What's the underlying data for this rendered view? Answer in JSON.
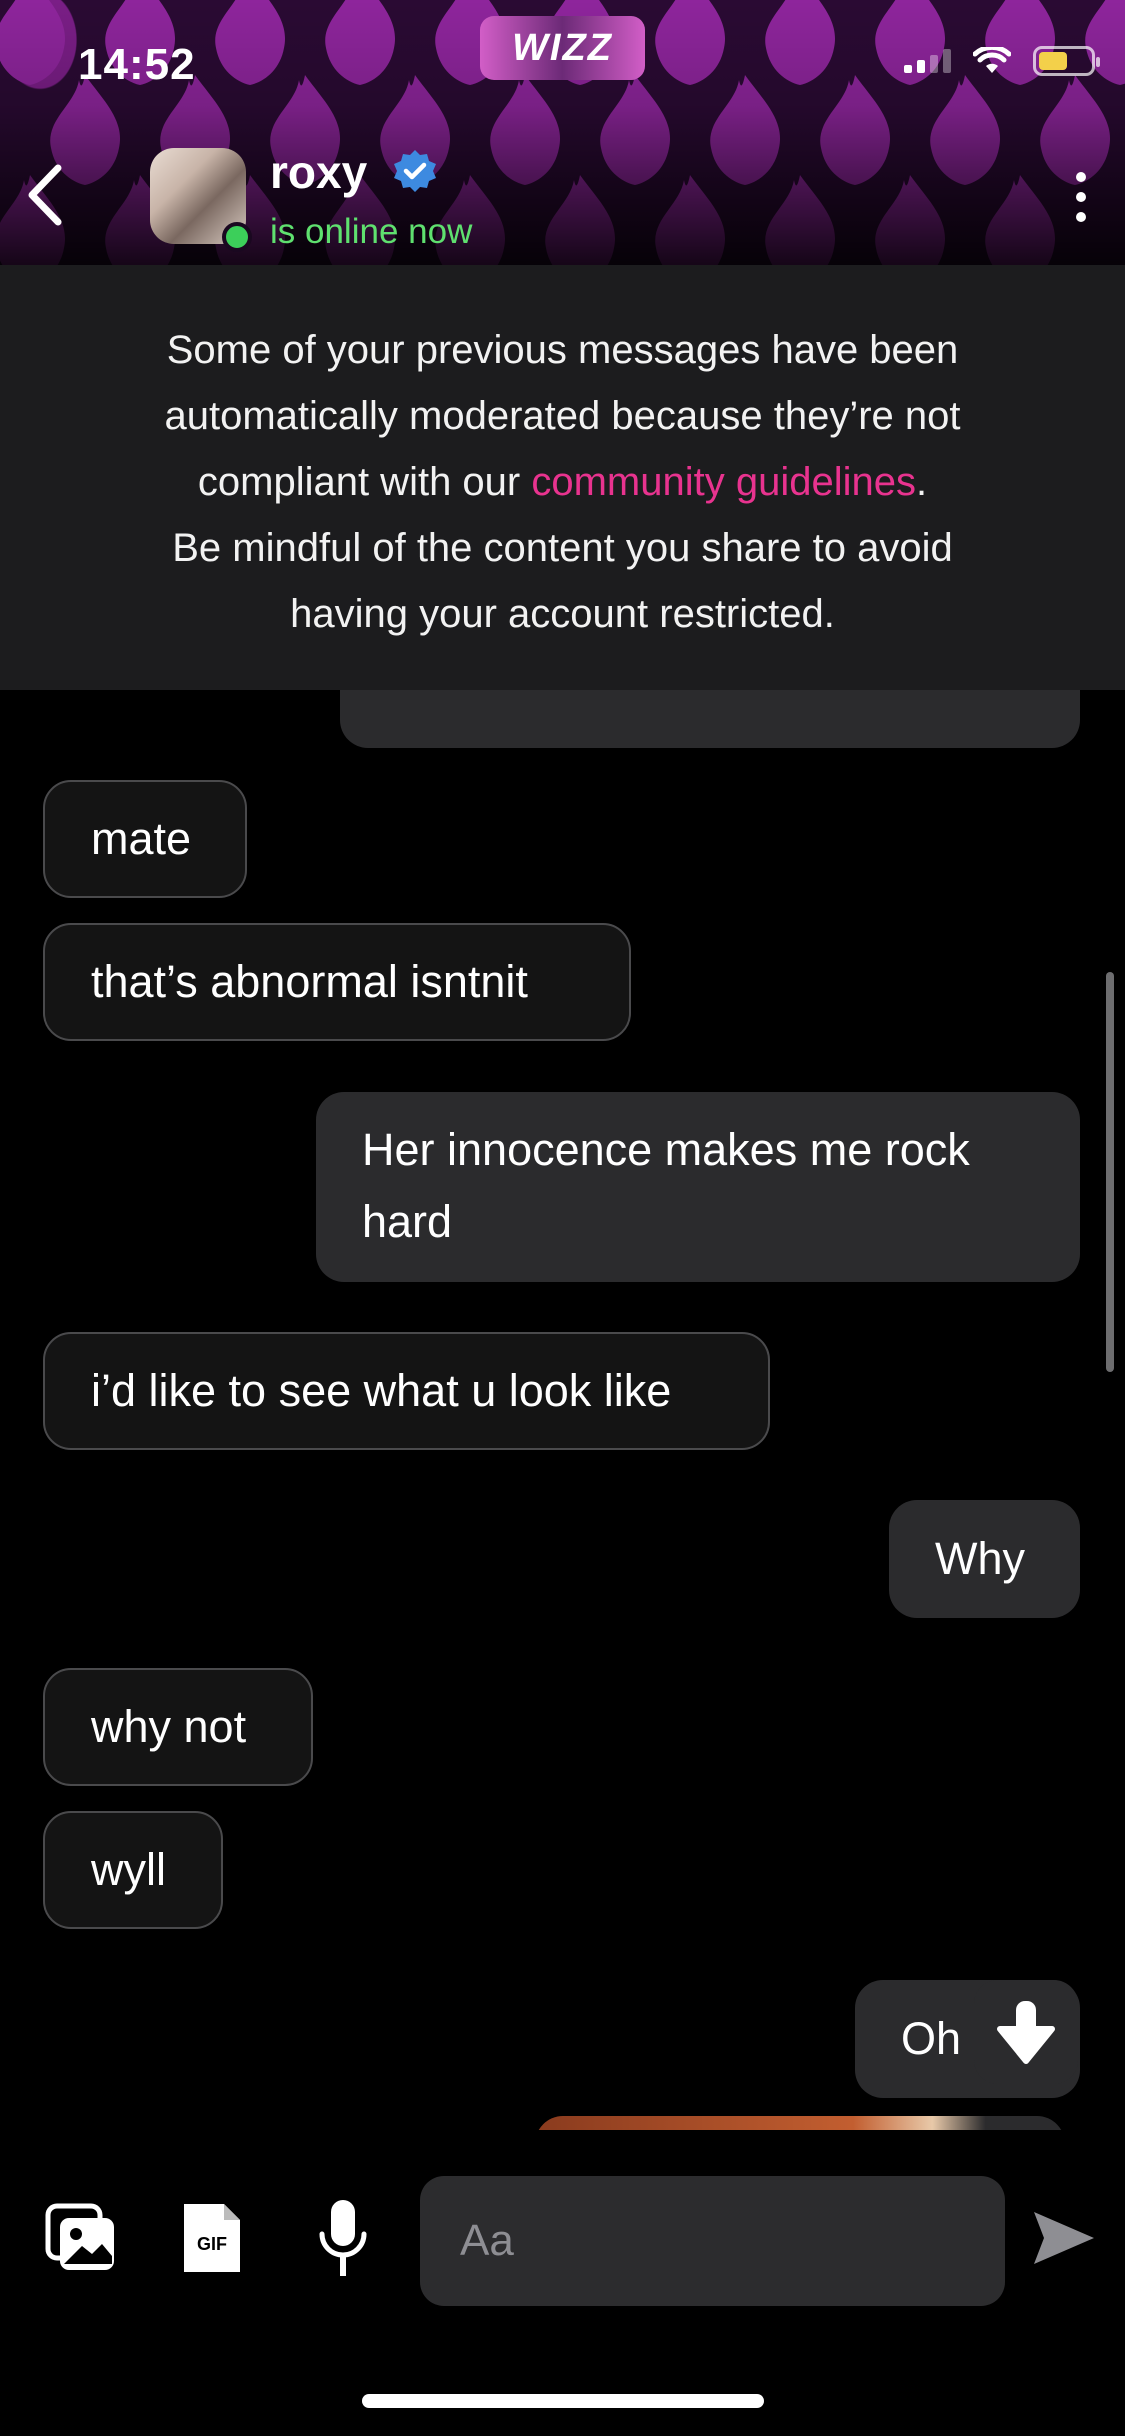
{
  "status_bar": {
    "time": "14:52",
    "logo": "WIZZ"
  },
  "header": {
    "contact_name": "roxy",
    "online_status": "is online now",
    "icons": [
      "back-chevron-icon",
      "verified-badge-icon",
      "more-vertical-icon"
    ]
  },
  "banner": {
    "line1": "Some of your previous messages have been",
    "line2": "automatically moderated because they’re not",
    "line3_pre": "compliant with our ",
    "line3_link": "community guidelines",
    "line3_post": ".",
    "line4": "Be mindful of the content you share to avoid",
    "line5": "having your account restricted."
  },
  "messages": [
    {
      "side": "in",
      "text": "mate"
    },
    {
      "side": "in",
      "text": "that’s abnormal isntnit"
    },
    {
      "side": "out",
      "line1": "Her innocence makes me rock",
      "line2": "hard"
    },
    {
      "side": "in",
      "text": "i’d like to see what u look like"
    },
    {
      "side": "out",
      "text": "Why"
    },
    {
      "side": "in",
      "text": "why not"
    },
    {
      "side": "in",
      "text": "wyll"
    },
    {
      "side": "out",
      "text": "Oh"
    }
  ],
  "composer": {
    "placeholder": "Aa",
    "gif_label": "GIF",
    "icons": [
      "photo-gallery-icon",
      "gif-icon",
      "microphone-icon",
      "send-icon"
    ]
  },
  "colors": {
    "accent_link": "#e8338f",
    "online": "#5fe06f",
    "verified": "#3d8ae0",
    "header_purple": "#7a1e86"
  }
}
